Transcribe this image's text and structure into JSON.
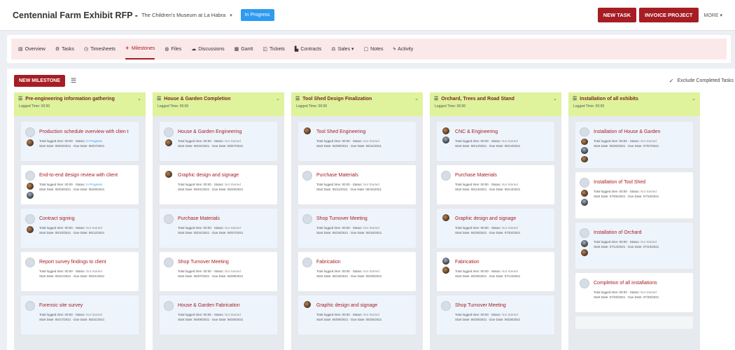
{
  "header": {
    "title": "Centennial Farm Exhibit RFP -",
    "client": "The Children's Museum at La Habra",
    "caret": "▾",
    "status": "In Progress",
    "new_task": "NEW TASK",
    "invoice": "INVOICE PROJECT",
    "more": "MORE ▾"
  },
  "nav": [
    {
      "icon": "▤",
      "icon_name": "overview-icon",
      "label": "Overview"
    },
    {
      "icon": "⚙",
      "icon_name": "tasks-icon",
      "label": "Tasks"
    },
    {
      "icon": "◷",
      "icon_name": "clock-icon",
      "label": "Timesheets"
    },
    {
      "icon": "✈",
      "icon_name": "milestone-icon",
      "label": "Milestones"
    },
    {
      "icon": "◍",
      "icon_name": "files-icon",
      "label": "Files"
    },
    {
      "icon": "☁",
      "icon_name": "discussions-icon",
      "label": "Discussions"
    },
    {
      "icon": "▦",
      "icon_name": "gantt-icon",
      "label": "Gantt"
    },
    {
      "icon": "◫",
      "icon_name": "tickets-icon",
      "label": "Tickets"
    },
    {
      "icon": "▙",
      "icon_name": "contracts-icon",
      "label": "Contracts"
    },
    {
      "icon": "⚖",
      "icon_name": "sales-icon",
      "label": "Sales ▾"
    },
    {
      "icon": "▢",
      "icon_name": "notes-icon",
      "label": "Notes"
    },
    {
      "icon": "ϟ",
      "icon_name": "activity-icon",
      "label": "Activity"
    }
  ],
  "toolbar": {
    "new_milestone": "NEW MILESTONE",
    "list_icon": "☰",
    "exclude_check": "✓",
    "exclude_label": "Exclude Completed Tasks"
  },
  "columns": [
    {
      "title": "Pre-engineering information gathering",
      "logged": "Logged Time: 00:00",
      "cards": [
        {
          "title": "Production schedule overview with clien t",
          "meta1a": "Total logged time: 00:00 · Status:",
          "status": "In Progress",
          "status_kind": "prog",
          "meta2": "Start Date: 05/03/2021 · Due Date: 05/07/2021",
          "avatars": [
            "blank",
            "photo"
          ]
        },
        {
          "title": "End-to-end design review with client",
          "meta1a": "Total logged time: 00:00 · Status:",
          "status": "In Progress",
          "status_kind": "prog",
          "meta2": "Start Date: 05/03/2021 · Due Date: 05/28/2021",
          "avatars": [
            "blank",
            "photo",
            "photo2"
          ]
        },
        {
          "title": "Contract signing",
          "meta1a": "Total logged time: 00:00 · Status:",
          "status": "Not Started",
          "status_kind": "not",
          "meta2": "Start Date: 05/10/2021 · Due Date: 05/12/2021",
          "avatars": [
            "blank",
            "photo"
          ]
        },
        {
          "title": "Report survey findings to client",
          "meta1a": "Total logged time: 00:00 · Status:",
          "status": "Not Started",
          "status_kind": "not",
          "meta2": "Start Date: 05/21/2021 · Due Date: 05/21/2021",
          "avatars": [
            "blank"
          ]
        },
        {
          "title": "Forensic site survey",
          "meta1a": "Total logged time: 00:00 · Status:",
          "status": "Not Started",
          "status_kind": "not",
          "meta2": "Start Date: 05/17/2021 · Due Date: 05/21/2021",
          "avatars": [
            "blank"
          ]
        }
      ]
    },
    {
      "title": "House & Garden Completion",
      "logged": "Logged Time: 00:00",
      "cards": [
        {
          "title": "House & Garden Engineering",
          "meta1a": "Total logged time: 00:00 · Status:",
          "status": "Not Started",
          "status_kind": "not",
          "meta2": "Start Date: 05/31/2021 · Due Date: 06/07/2021",
          "avatars": [
            "blank",
            "photo"
          ]
        },
        {
          "title": "Graphic design and signage",
          "meta1a": "Total logged time: 00:00 · Status:",
          "status": "Not Started",
          "status_kind": "not",
          "meta2": "Start Date: 06/01/2021 · Due Date: 06/29/2021",
          "avatars": [
            "photo"
          ]
        },
        {
          "title": "Purchase Materials",
          "meta1a": "Total logged time: 00:00 · Status:",
          "status": "Not Started",
          "status_kind": "not",
          "meta2": "Start Date: 05/31/2021 · Due Date: 06/07/2021",
          "avatars": [
            "blank"
          ]
        },
        {
          "title": "Shop Turnover Meeting",
          "meta1a": "Total logged time: 00:00 · Status:",
          "status": "Not Started",
          "status_kind": "not",
          "meta2": "Start Date: 06/07/2021 · Due Date: 06/08/2021",
          "avatars": [
            "blank"
          ]
        },
        {
          "title": "House & Garden Fabrication",
          "meta1a": "Total logged time: 00:00 · Status:",
          "status": "Not Started",
          "status_kind": "not",
          "meta2": "Start Date: 06/08/2021 · Due Date: 06/29/2021",
          "avatars": [
            "blank"
          ]
        }
      ]
    },
    {
      "title": "Tool Shed Design Finalization",
      "logged": "Logged Time: 00:00",
      "cards": [
        {
          "title": "Tool Shed Engineering",
          "meta1a": "Total logged time: 00:00 · Status:",
          "status": "Not Started",
          "status_kind": "not",
          "meta2": "Start Date: 06/08/2021 · Due Date: 06/11/2021",
          "avatars": [
            "photo"
          ]
        },
        {
          "title": "Purchase Materials",
          "meta1a": "Total logged time: 00:00 · Status:",
          "status": "Not Started",
          "status_kind": "not",
          "meta2": "Start Date: 06/11/2021 · Due Date: 06/15/2021",
          "avatars": [
            "blank"
          ]
        },
        {
          "title": "Shop Turnover Meeting",
          "meta1a": "Total logged time: 00:00 · Status:",
          "status": "Not Started",
          "status_kind": "not",
          "meta2": "Start Date: 06/16/2021 · Due Date: 06/16/2021",
          "avatars": [
            "blank"
          ]
        },
        {
          "title": "Fabrication",
          "meta1a": "Total logged time: 00:00 · Status:",
          "status": "Not Started",
          "status_kind": "not",
          "meta2": "Start Date: 06/16/2021 · Due Date: 06/29/2021",
          "avatars": [
            "blank"
          ]
        },
        {
          "title": "Graphic design and signage",
          "meta1a": "Total logged time: 00:00 · Status:",
          "status": "Not Started",
          "status_kind": "not",
          "meta2": "Start Date: 06/08/2021 · Due Date: 06/25/2021",
          "avatars": [
            "photo"
          ]
        }
      ]
    },
    {
      "title": "Orchard, Trees and Road Stand",
      "logged": "Logged Time: 00:00",
      "cards": [
        {
          "title": "CNC & Engineering",
          "meta1a": "Total logged time: 00:00 · Status:",
          "status": "Not Started",
          "status_kind": "not",
          "meta2": "Start Date: 06/14/2021 · Due Date: 06/14/2021",
          "avatars": [
            "photo",
            "photo2"
          ]
        },
        {
          "title": "Purchase Materials",
          "meta1a": "Total logged time: 00:00 · Status:",
          "status": "Not Started",
          "status_kind": "not",
          "meta2": "Start Date: 06/14/2021 · Due Date: 06/14/2021",
          "avatars": [
            "blank"
          ]
        },
        {
          "title": "Graphic design and signage",
          "meta1a": "Total logged time: 00:00 · Status:",
          "status": "Not Started",
          "status_kind": "not",
          "meta2": "Start Date: 06/29/2021 · Due Date: 07/02/2021",
          "avatars": [
            "photo"
          ]
        },
        {
          "title": "Fabrication",
          "meta1a": "Total logged time: 00:00 · Status:",
          "status": "Not Started",
          "status_kind": "not",
          "meta2": "Start Date: 06/29/2021 · Due Date: 07/14/2021",
          "avatars": [
            "photo2",
            "photo"
          ]
        },
        {
          "title": "Shop Turnover Meeting",
          "meta1a": "Total logged time: 00:00 · Status:",
          "status": "Not Started",
          "status_kind": "not",
          "meta2": "Start Date: 06/28/2021 · Due Date: 06/28/2021",
          "avatars": [
            "blank"
          ]
        }
      ]
    },
    {
      "title": "Installation of all exhibits",
      "logged": "Logged Time: 00:00",
      "cards": [
        {
          "title": "Installation of House & Garden",
          "meta1a": "Total logged time: 00:00 · Status:",
          "status": "Not Started",
          "status_kind": "not",
          "meta2": "Start Date: 06/30/2021 · Due Date: 07/07/2021",
          "avatars": [
            "blank",
            "photo",
            "photo2",
            "photo"
          ],
          "tall": true
        },
        {
          "title": "Installation of Tool Shed",
          "meta1a": "Total logged time: 00:00 · Status:",
          "status": "Not Started",
          "status_kind": "not",
          "meta2": "Start Date: 07/06/2021 · Due Date: 07/16/2021",
          "avatars": [
            "blank",
            "photo",
            "photo2"
          ],
          "tall": true
        },
        {
          "title": "Installation of Orchard",
          "meta1a": "Total logged time: 00:00 · Status:",
          "status": "Not Started",
          "status_kind": "not",
          "meta2": "Start Date: 07/14/2021 · Due Date: 07/23/2021",
          "avatars": [
            "blank",
            "photo2",
            "photo"
          ],
          "tall": true
        },
        {
          "title": "Completion of all installations",
          "meta1a": "Total logged time: 00:00 · Status:",
          "status": "Not Started",
          "status_kind": "not",
          "meta2": "Start Date: 07/26/2021 · Due Date: 07/30/2021",
          "avatars": [
            "blank"
          ]
        }
      ]
    }
  ],
  "colors": {
    "brand_red": "#a61d24",
    "status_blue": "#2d9bf0",
    "column_header": "#dff29c",
    "nav_bg": "#fbe9ea"
  }
}
